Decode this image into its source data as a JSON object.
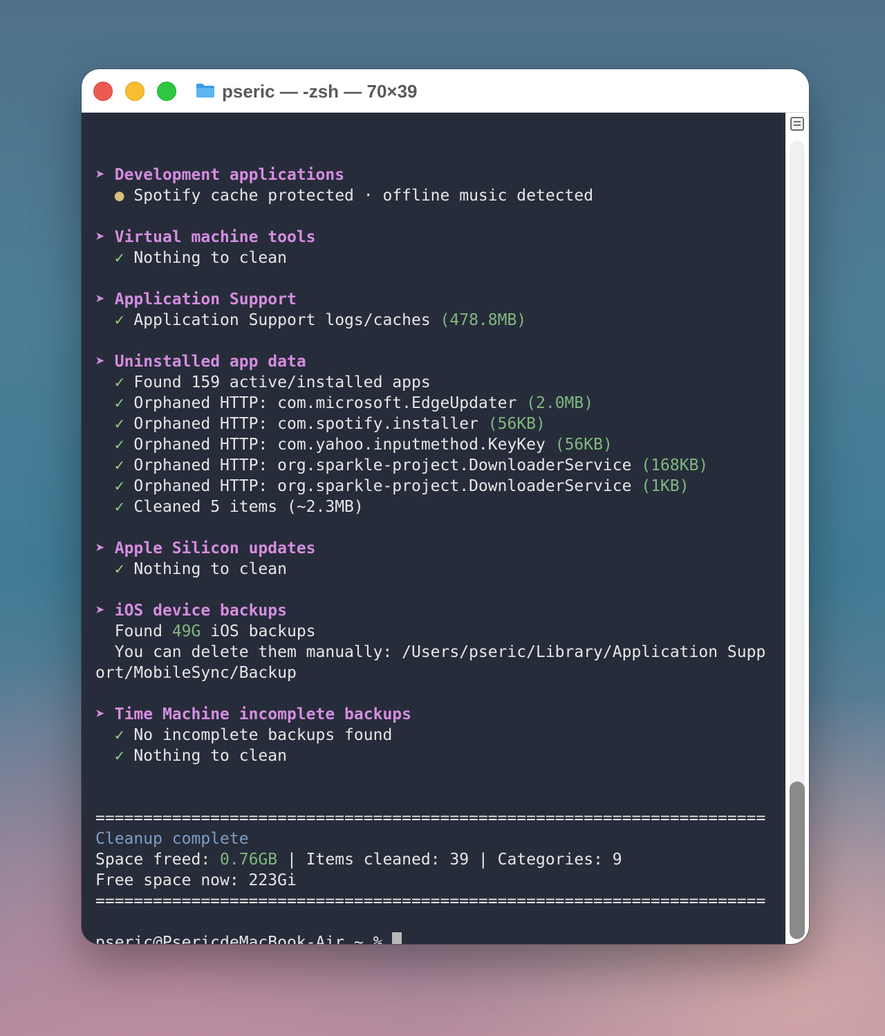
{
  "window": {
    "title": "pseric — -zsh — 70×39"
  },
  "sections": [
    {
      "heading": "Development applications",
      "lines": [
        {
          "icon": "dot",
          "text": "Spotify cache protected · offline music detected",
          "extra": ""
        }
      ]
    },
    {
      "heading": "Virtual machine tools",
      "lines": [
        {
          "icon": "check",
          "text": "Nothing to clean",
          "extra": ""
        }
      ]
    },
    {
      "heading": "Application Support",
      "lines": [
        {
          "icon": "check",
          "text": "Application Support logs/caches",
          "extra": "(478.8MB)"
        }
      ]
    },
    {
      "heading": "Uninstalled app data",
      "lines": [
        {
          "icon": "check",
          "text": "Found 159 active/installed apps",
          "extra": ""
        },
        {
          "icon": "check",
          "text": "Orphaned HTTP: com.microsoft.EdgeUpdater",
          "extra": "(2.0MB)"
        },
        {
          "icon": "check",
          "text": "Orphaned HTTP: com.spotify.installer",
          "extra": "(56KB)"
        },
        {
          "icon": "check",
          "text": "Orphaned HTTP: com.yahoo.inputmethod.KeyKey",
          "extra": "(56KB)"
        },
        {
          "icon": "check",
          "text": "Orphaned HTTP: org.sparkle-project.DownloaderService",
          "extra": "(168KB)"
        },
        {
          "icon": "check",
          "text": "Orphaned HTTP: org.sparkle-project.DownloaderService",
          "extra": "(1KB)"
        },
        {
          "icon": "check",
          "text": "Cleaned 5 items (~2.3MB)",
          "extra": ""
        }
      ]
    },
    {
      "heading": "Apple Silicon updates",
      "lines": [
        {
          "icon": "check",
          "text": "Nothing to clean",
          "extra": ""
        }
      ]
    }
  ],
  "ios": {
    "heading": "iOS device backups",
    "found_prefix": "Found",
    "found_value": "49G",
    "found_suffix": "iOS backups",
    "delete_line_1": "You can delete them manually: /Users/pseric/Library/Application Supp",
    "delete_line_2": "ort/MobileSync/Backup"
  },
  "time_machine": {
    "heading": "Time Machine incomplete backups",
    "lines": [
      "No incomplete backups found",
      "Nothing to clean"
    ]
  },
  "summary": {
    "rule": "======================================================================",
    "title": "Cleanup complete",
    "space_label": "Space freed:",
    "space_value": "0.76GB",
    "rest": "| Items cleaned: 39 | Categories: 9",
    "free_space": "Free space now: 223Gi"
  },
  "prompt": {
    "text": "pseric@PsericdeMacBook-Air ~ %"
  },
  "glyphs": {
    "arrow": "➤",
    "check": "✓",
    "dot": "●"
  },
  "colors": {
    "heading": "#d48de0",
    "check": "#8fcf7d",
    "size": "#7fb77f",
    "summary_title": "#7e9dc4",
    "terminal_bg": "#272c3a"
  }
}
